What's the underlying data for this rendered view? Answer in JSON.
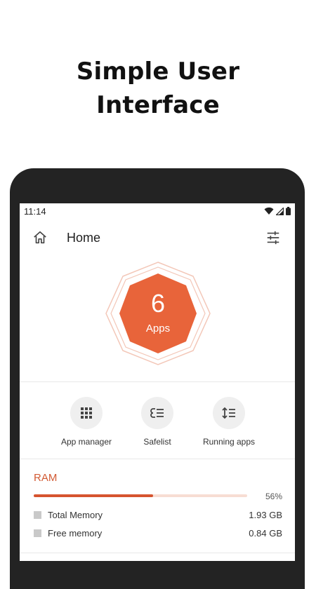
{
  "headline": {
    "line1": "Simple User",
    "line2": "Interface"
  },
  "status_bar": {
    "time": "11:14",
    "icons": [
      "wifi-icon",
      "signal-icon",
      "battery-icon"
    ]
  },
  "app_bar": {
    "title": "Home",
    "left_icon": "home-icon",
    "right_icon": "tune-icon"
  },
  "badge": {
    "count": "6",
    "label": "Apps",
    "color": "#E8643A"
  },
  "actions": [
    {
      "label": "App manager",
      "icon": "grid-icon"
    },
    {
      "label": "Safelist",
      "icon": "safelist-icon"
    },
    {
      "label": "Running apps",
      "icon": "sort-icon"
    }
  ],
  "ram": {
    "title": "RAM",
    "percent_label": "56%",
    "percent": 0.56,
    "rows": [
      {
        "name": "Total Memory",
        "value": "1.93 GB"
      },
      {
        "name": "Free memory",
        "value": "0.84 GB"
      }
    ]
  },
  "colors": {
    "accent": "#D6542F",
    "track": "#F7DDD3"
  }
}
